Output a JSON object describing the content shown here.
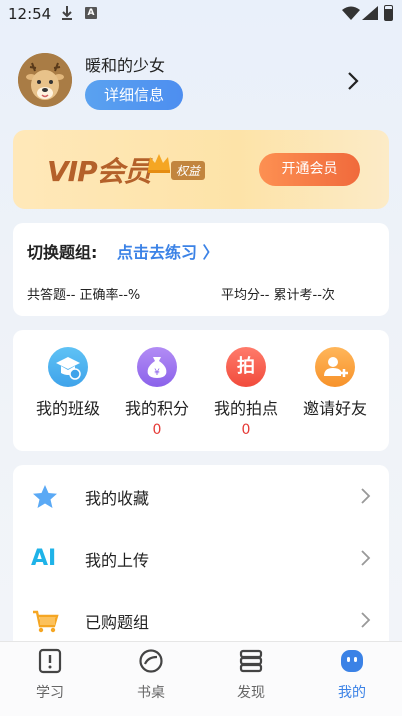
{
  "status_bar": {
    "time": "12:54",
    "a_icon": "A"
  },
  "profile": {
    "username": "暖和的少女",
    "detail_button": "详细信息"
  },
  "vip": {
    "title": "VIP会员",
    "tag": "权益",
    "button": "开通会员"
  },
  "practice": {
    "switch_label": "切换题组:",
    "switch_link": "点击去练习 〉",
    "stats_left": "共答题-- 正确率--%",
    "stats_right": "平均分-- 累计考--次"
  },
  "grid": [
    {
      "label": "我的班级",
      "icon": "graduation-cap-icon",
      "count": ""
    },
    {
      "label": "我的积分",
      "icon": "money-bag-icon",
      "count": "0"
    },
    {
      "label": "我的拍点",
      "icon": "pai-icon",
      "count": "0",
      "glyph": "拍"
    },
    {
      "label": "邀请好友",
      "icon": "add-user-icon",
      "count": ""
    }
  ],
  "menu": [
    {
      "label": "我的收藏",
      "icon": "star-icon"
    },
    {
      "label": "我的上传",
      "icon": "ai-icon",
      "glyph": "AI"
    },
    {
      "label": "已购题组",
      "icon": "cart-icon"
    }
  ],
  "nav": [
    {
      "label": "学习",
      "icon": "book-icon"
    },
    {
      "label": "书桌",
      "icon": "desk-icon"
    },
    {
      "label": "发现",
      "icon": "stack-icon"
    },
    {
      "label": "我的",
      "icon": "smiley-icon"
    }
  ],
  "colors": {
    "accent": "#3b82e6",
    "vip_text": "#b4612a",
    "vip_button": "#f06a3c",
    "count_red": "#e53935"
  }
}
